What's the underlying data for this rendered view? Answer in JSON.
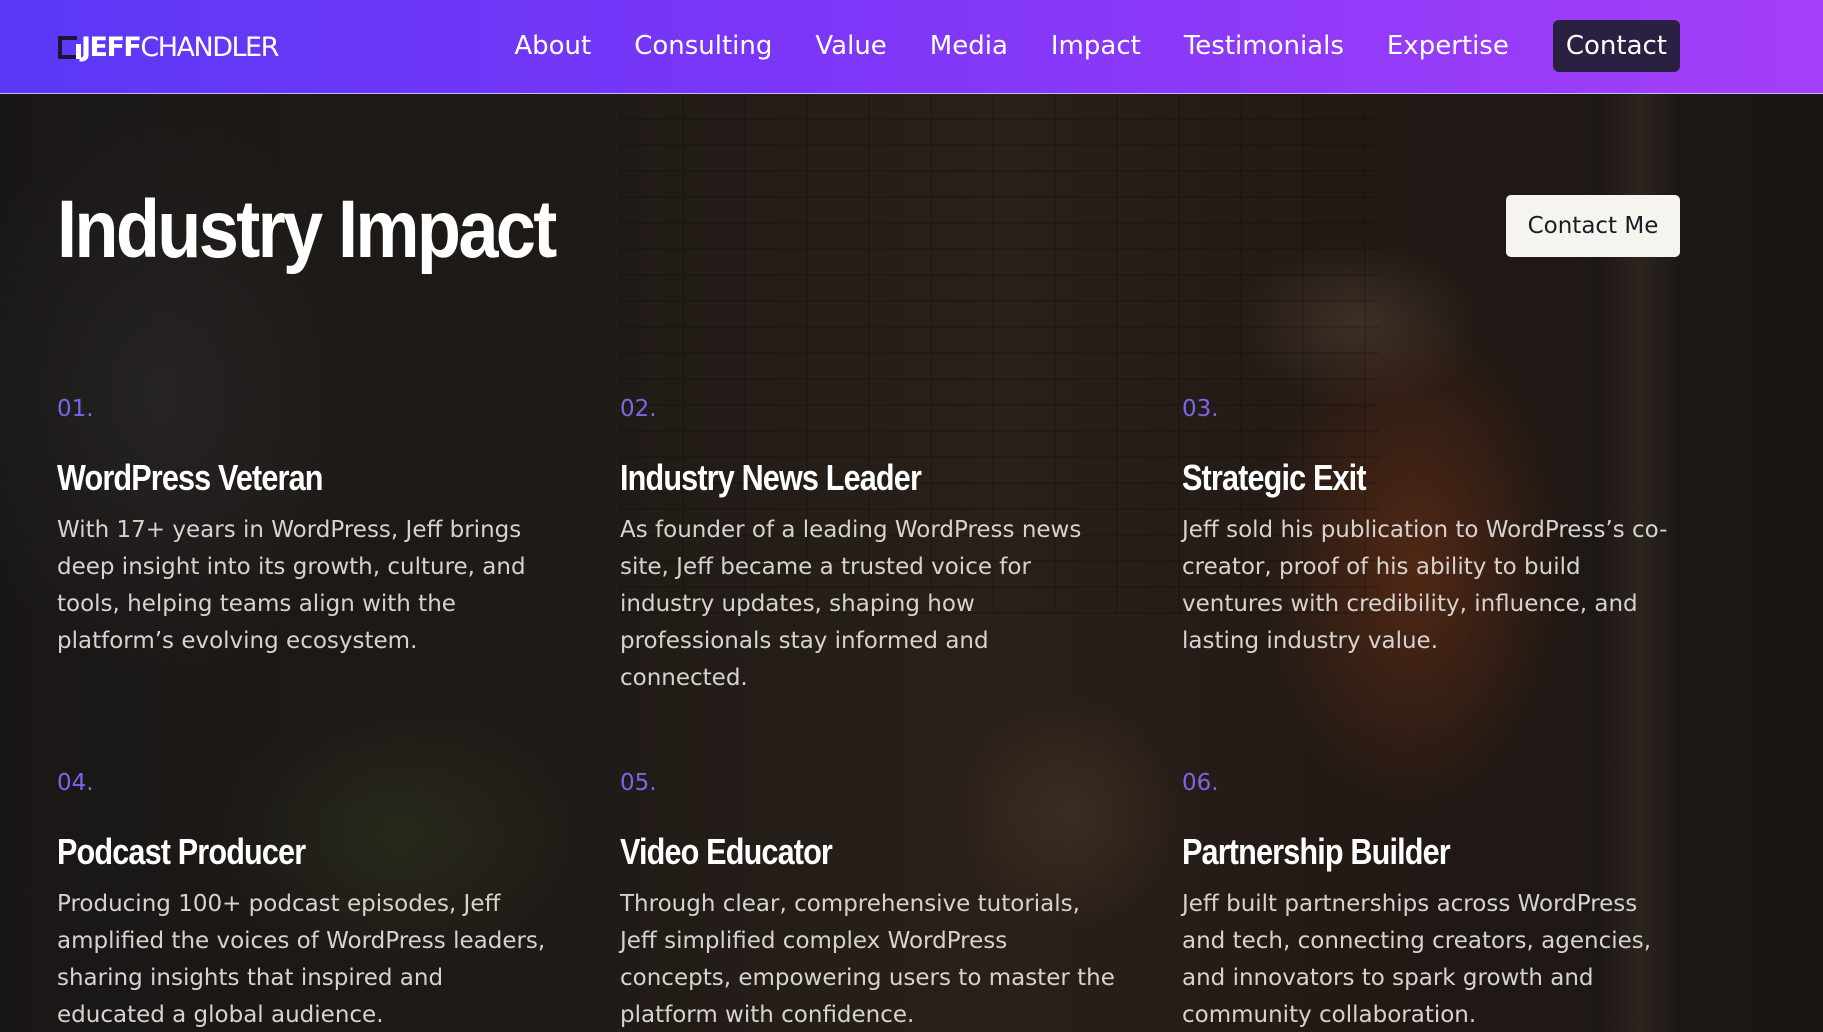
{
  "nav": {
    "logo_first": "JEFF",
    "logo_last": "CHANDLER",
    "links": [
      "About",
      "Consulting",
      "Value",
      "Media",
      "Impact",
      "Testimonials",
      "Expertise"
    ],
    "contact_label": "Contact"
  },
  "hero": {
    "title": "Industry Impact",
    "contact_button": "Contact Me"
  },
  "cards": [
    {
      "number": "01.",
      "title": "WordPress Veteran",
      "description": "With 17+ years in WordPress, Jeff brings deep insight into its growth, culture, and tools, helping teams align with the platform’s evolving ecosystem."
    },
    {
      "number": "02.",
      "title": "Industry News Leader",
      "description": "As founder of a leading WordPress news site, Jeff became a trusted voice for industry updates, shaping how professionals stay informed and connected."
    },
    {
      "number": "03.",
      "title": "Strategic Exit",
      "description": "Jeff sold his publication to WordPress’s co-creator, proof of his ability to build ventures with credibility, influence, and lasting industry value."
    },
    {
      "number": "04.",
      "title": "Podcast Producer",
      "description": "Producing 100+ podcast episodes, Jeff amplified the voices of WordPress leaders, sharing insights that inspired and educated a global audience."
    },
    {
      "number": "05.",
      "title": "Video Educator",
      "description": "Through clear, comprehensive tutorials, Jeff simplified complex WordPress concepts, empowering users to master the platform with confidence."
    },
    {
      "number": "06.",
      "title": "Partnership Builder",
      "description": "Jeff built partnerships across WordPress and tech, connecting creators, agencies, and innovators to spark growth and community collaboration."
    }
  ],
  "colors": {
    "nav_gradient_start": "#5a38f6",
    "nav_gradient_end": "#a43ff9",
    "accent_number": "#7b66e8",
    "contact_nav_bg": "#2a2142",
    "contact_me_bg": "#f5f4ee"
  }
}
